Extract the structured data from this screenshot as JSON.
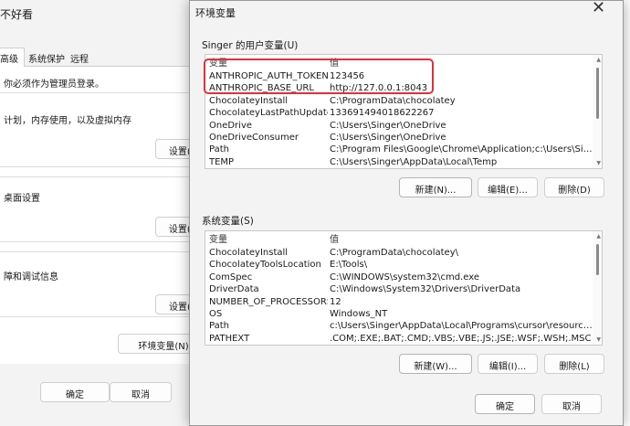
{
  "background_window": {
    "title": "不好看",
    "tabs": [
      "高级",
      "系统保护",
      "远程"
    ],
    "admin_notice": "你必须作为管理员登录。",
    "performance_text": "计划，内存使用，以及虚拟内存",
    "performance_button": "设置(S",
    "profile_text": "桌面设置",
    "profile_button": "设置(E",
    "startup_text": "障和调试信息",
    "startup_button": "设置(T",
    "env_button": "环境变量(N)",
    "ok": "确定",
    "cancel": "取消"
  },
  "dialog": {
    "title": "环境变量",
    "close_glyph": "✕",
    "user_section": {
      "label": "Singer 的用户变量(U)",
      "columns": [
        "变量",
        "值"
      ],
      "rows": [
        {
          "name": "ANTHROPIC_AUTH_TOKEN",
          "value": "123456"
        },
        {
          "name": "ANTHROPIC_BASE_URL",
          "value": "http://127.0.0.1:8043"
        },
        {
          "name": "ChocolateyInstall",
          "value": "C:\\ProgramData\\chocolatey"
        },
        {
          "name": "ChocolateyLastPathUpdate",
          "value": "133691494018622267"
        },
        {
          "name": "OneDrive",
          "value": "C:\\Users\\Singer\\OneDrive"
        },
        {
          "name": "OneDriveConsumer",
          "value": "C:\\Users\\Singer\\OneDrive"
        },
        {
          "name": "Path",
          "value": "C:\\Program Files\\Google\\Chrome\\Application;c:\\Users\\Singer\\A..."
        },
        {
          "name": "TEMP",
          "value": "C:\\Users\\Singer\\AppData\\Local\\Temp"
        }
      ],
      "buttons": {
        "new": "新建(N)...",
        "edit": "编辑(E)...",
        "delete": "删除(D)"
      }
    },
    "system_section": {
      "label": "系统变量(S)",
      "columns": [
        "变量",
        "值"
      ],
      "rows": [
        {
          "name": "ChocolateyInstall",
          "value": "C:\\ProgramData\\chocolatey\\"
        },
        {
          "name": "ChocolateyToolsLocation",
          "value": "E:\\Tools\\"
        },
        {
          "name": "ComSpec",
          "value": "C:\\WINDOWS\\system32\\cmd.exe"
        },
        {
          "name": "DriverData",
          "value": "C:\\Windows\\System32\\Drivers\\DriverData"
        },
        {
          "name": "NUMBER_OF_PROCESSORS",
          "value": "12"
        },
        {
          "name": "OS",
          "value": "Windows_NT"
        },
        {
          "name": "Path",
          "value": "c:\\Users\\Singer\\AppData\\Local\\Programs\\cursor\\resources\\app..."
        },
        {
          "name": "PATHEXT",
          "value": ".COM;.EXE;.BAT;.CMD;.VBS;.VBE;.JS;.JSE;.WSF;.WSH;.MSC"
        }
      ],
      "buttons": {
        "new": "新建(W)...",
        "edit": "编辑(I)...",
        "delete": "删除(L)"
      }
    },
    "ok": "确定",
    "cancel": "取消"
  },
  "colors": {
    "highlight": "#e0303a",
    "dialog_bg": "#f3f3f3"
  }
}
